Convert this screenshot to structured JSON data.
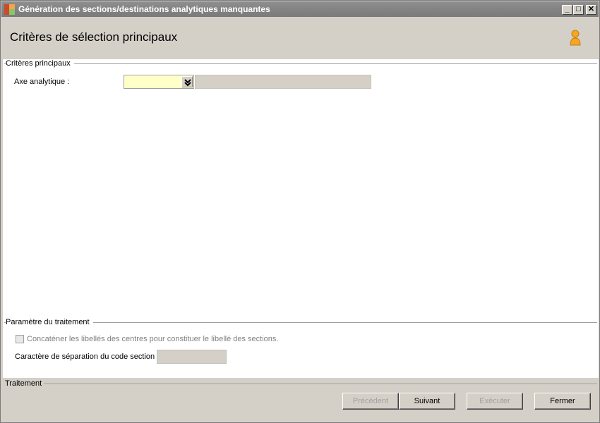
{
  "window": {
    "title": "Génération des sections/destinations analytiques manquantes",
    "minimize_glyph": "_",
    "maximize_glyph": "□",
    "close_glyph": "✕"
  },
  "header": {
    "title": "Critères de sélection principaux",
    "icon": "user-icon"
  },
  "criteria_section": {
    "label": "Critères principaux",
    "axe_label": "Axe analytique :",
    "axe_value": ""
  },
  "treatment_params": {
    "label": "Paramètre du traitement",
    "concat_label": "Concaténer les libellés des centres pour constituer le libellé des sections.",
    "concat_checked": false,
    "separator_label": "Caractère de séparation du code section :",
    "separator_value": ""
  },
  "footer": {
    "label": "Traitement",
    "buttons": {
      "previous": "Précédent",
      "next": "Suivant",
      "execute": "Exécuter",
      "close": "Fermer"
    }
  },
  "colors": {
    "window_bg": "#d4d0c8",
    "titlebar": "#7f7f7f",
    "combo_bg": "#ffffc8",
    "user_icon": "#f5a623"
  }
}
